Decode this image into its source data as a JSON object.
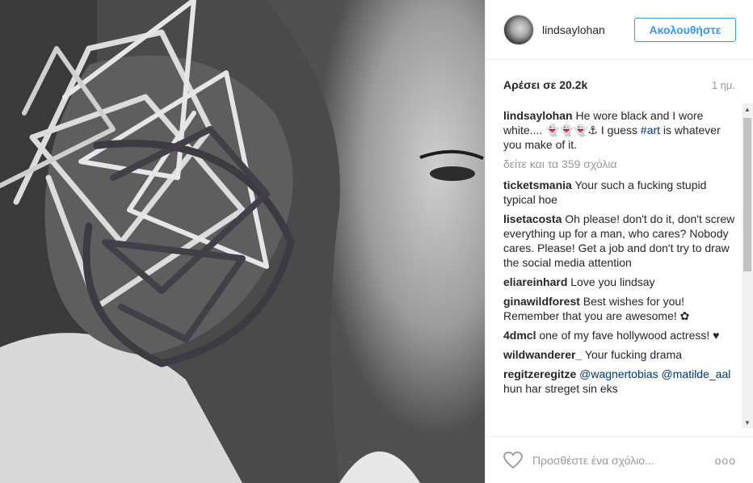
{
  "post": {
    "photo_alt": "",
    "header": {
      "username": "lindsaylohan",
      "follow_label": "Ακολουθήστε"
    },
    "likes": "Αρέσει σε 20.2k",
    "time": "1 ημ.",
    "caption": {
      "user": "lindsaylohan",
      "text_before": "He wore black and I wore white.... 👻👻👻⚓ I guess ",
      "hashtag": "#art",
      "text_after": " is whatever you make of it."
    },
    "view_more": "δείτε και τα 359 σχόλια",
    "comments": [
      {
        "user": "ticketsmania",
        "text": "Your such a fucking stupid typical hoe"
      },
      {
        "user": "lisetacosta",
        "text": "Oh please! don't do it, don't screw everything up for a man, who cares? Nobody cares. Please! Get a job and don't try to draw the social media attention"
      },
      {
        "user": "eliareinhard",
        "text": "Love you lindsay"
      },
      {
        "user": "ginawildforest",
        "text": "Best wishes for you! Remember that you are awesome! ✿"
      },
      {
        "user": "4dmcl",
        "text": "one of my fave hollywood actress! ♥"
      },
      {
        "user": "wildwanderer_",
        "text": "Your fucking drama"
      },
      {
        "user": "regitzeregitze",
        "mentions": "@wagnertobias",
        "mentions2": "@matilde_aal",
        "text": "hun har streget sin eks"
      }
    ],
    "footer": {
      "placeholder": "Προσθέστε ένα σχόλιο...",
      "more": "ooo"
    }
  }
}
